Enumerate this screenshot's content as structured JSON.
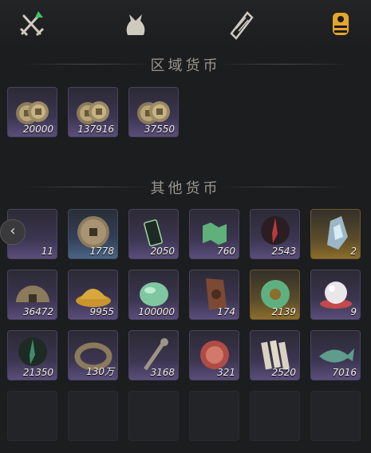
{
  "tabs": [
    {
      "icon": "crossed-swords-icon",
      "active": false
    },
    {
      "icon": "pouch-icon",
      "active": false
    },
    {
      "icon": "scroll-icon",
      "active": false
    },
    {
      "icon": "coins-stack-icon",
      "active": true
    }
  ],
  "sections": {
    "regional": {
      "title": "区域货币"
    },
    "other": {
      "title": "其他货币"
    }
  },
  "regional_items": [
    {
      "name": "coins-stack-item",
      "qty": "20000",
      "rarity": "purple"
    },
    {
      "name": "coins-stack-item",
      "qty": "137916",
      "rarity": "purple"
    },
    {
      "name": "coins-stack-item",
      "qty": "37550",
      "rarity": "purple"
    }
  ],
  "other_items": [
    {
      "name": "crescent-jade-item",
      "qty": "11",
      "rarity": "purple"
    },
    {
      "name": "bronze-coin-item",
      "qty": "1778",
      "rarity": "blue"
    },
    {
      "name": "jade-token-item",
      "qty": "2050",
      "rarity": "purple"
    },
    {
      "name": "map-fragment-item",
      "qty": "760",
      "rarity": "purple"
    },
    {
      "name": "red-feather-item",
      "qty": "2543",
      "rarity": "purple"
    },
    {
      "name": "crystal-shard-item",
      "qty": "2",
      "rarity": "gold"
    },
    {
      "name": "half-coin-item",
      "qty": "36472",
      "rarity": "purple"
    },
    {
      "name": "rice-grain-item",
      "qty": "9955",
      "rarity": "purple"
    },
    {
      "name": "jade-stone-item",
      "qty": "100000",
      "rarity": "purple"
    },
    {
      "name": "bronze-plaque-item",
      "qty": "174",
      "rarity": "purple"
    },
    {
      "name": "jade-ring-item",
      "qty": "2139",
      "rarity": "gold"
    },
    {
      "name": "pearl-item",
      "qty": "9",
      "rarity": "purple"
    },
    {
      "name": "green-feather-item",
      "qty": "21350",
      "rarity": "purple"
    },
    {
      "name": "coin-string-item",
      "qty": "130万",
      "rarity": "purple"
    },
    {
      "name": "coin-sword-item",
      "qty": "3168",
      "rarity": "purple"
    },
    {
      "name": "red-medallion-item",
      "qty": "321",
      "rarity": "purple"
    },
    {
      "name": "bamboo-slips-item",
      "qty": "2520",
      "rarity": "purple"
    },
    {
      "name": "jade-fish-item",
      "qty": "7016",
      "rarity": "purple"
    }
  ],
  "side_button": {
    "label": "‹"
  }
}
